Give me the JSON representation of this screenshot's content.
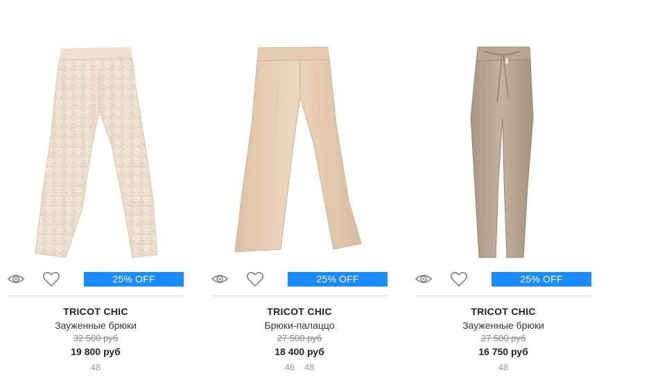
{
  "products": [
    {
      "brand": "TRICOT CHIC",
      "name": "Зауженные брюки",
      "old_price": "32 500 руб",
      "new_price": "19 800 руб",
      "discount": "25% OFF",
      "sizes": [
        "48"
      ],
      "image": "lace-pants-image"
    },
    {
      "brand": "TRICOT CHIC",
      "name": "Брюки-палаццо",
      "old_price": "27 500 руб",
      "new_price": "18 400 руб",
      "discount": "25% OFF",
      "sizes": [
        "46",
        "48"
      ],
      "image": "palazzo-pants-image"
    },
    {
      "brand": "TRICOT CHIC",
      "name": "Зауженные брюки",
      "old_price": "27 500 руб",
      "new_price": "16 750 руб",
      "discount": "25% OFF",
      "sizes": [
        "48"
      ],
      "image": "tapered-pants-image"
    }
  ],
  "icons": {
    "quick_view": "eye-icon",
    "wishlist": "heart-icon"
  },
  "colors": {
    "badge": "#1a8cff",
    "icon_gray": "#8a8a8a",
    "divider": "#d9d9d9"
  }
}
